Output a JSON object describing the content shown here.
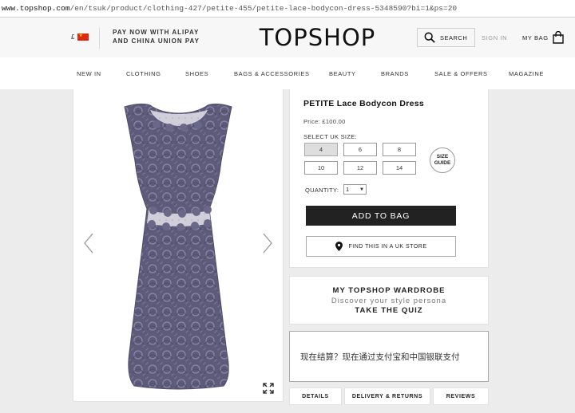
{
  "browser": {
    "url_host": "www.topshop.com",
    "url_path": "/en/tsuk/product/clothing-427/petite-455/petite-lace-bodycon-dress-5348590?bi=1&ps=20"
  },
  "header": {
    "currency": "£",
    "pay_line1": "PAY NOW WITH ALIPAY",
    "pay_line2": "AND CHINA UNION PAY",
    "logo": "TOPSHOP",
    "search_label": "SEARCH",
    "signin_label": "SIGN IN",
    "bag_label": "MY BAG"
  },
  "nav": {
    "items": [
      "NEW IN",
      "CLOTHING",
      "SHOES",
      "BAGS & ACCESSORIES",
      "BEAUTY",
      "BRANDS",
      "SALE & OFFERS",
      "MAGAZINE"
    ]
  },
  "product": {
    "name": "PETITE Lace Bodycon Dress",
    "price": "Price: £100.00",
    "size_label": "SELECT UK SIZE:",
    "sizes": [
      "4",
      "6",
      "8",
      "10",
      "12",
      "14"
    ],
    "selected_size": "4",
    "size_guide_line1": "SIZE",
    "size_guide_line2": "GUIDE",
    "quantity_label": "QUANTITY:",
    "quantity_value": "1",
    "add_to_bag": "ADD TO BAG",
    "find_store": "FIND THIS IN A UK STORE"
  },
  "wardrobe": {
    "title": "MY TOPSHOP WARDROBE",
    "subtitle": "Discover your style persona",
    "cta": "TAKE THE QUIZ"
  },
  "alipay_banner": "现在结算？现在通过支付宝和中国银联支付",
  "tabs": [
    "DETAILS",
    "DELIVERY & RETURNS",
    "REVIEWS"
  ],
  "colors": {
    "dress": "#5e5a7a",
    "button_dark": "#222222",
    "header_bg": "#f7f7f7",
    "page_bg": "#ececec"
  }
}
